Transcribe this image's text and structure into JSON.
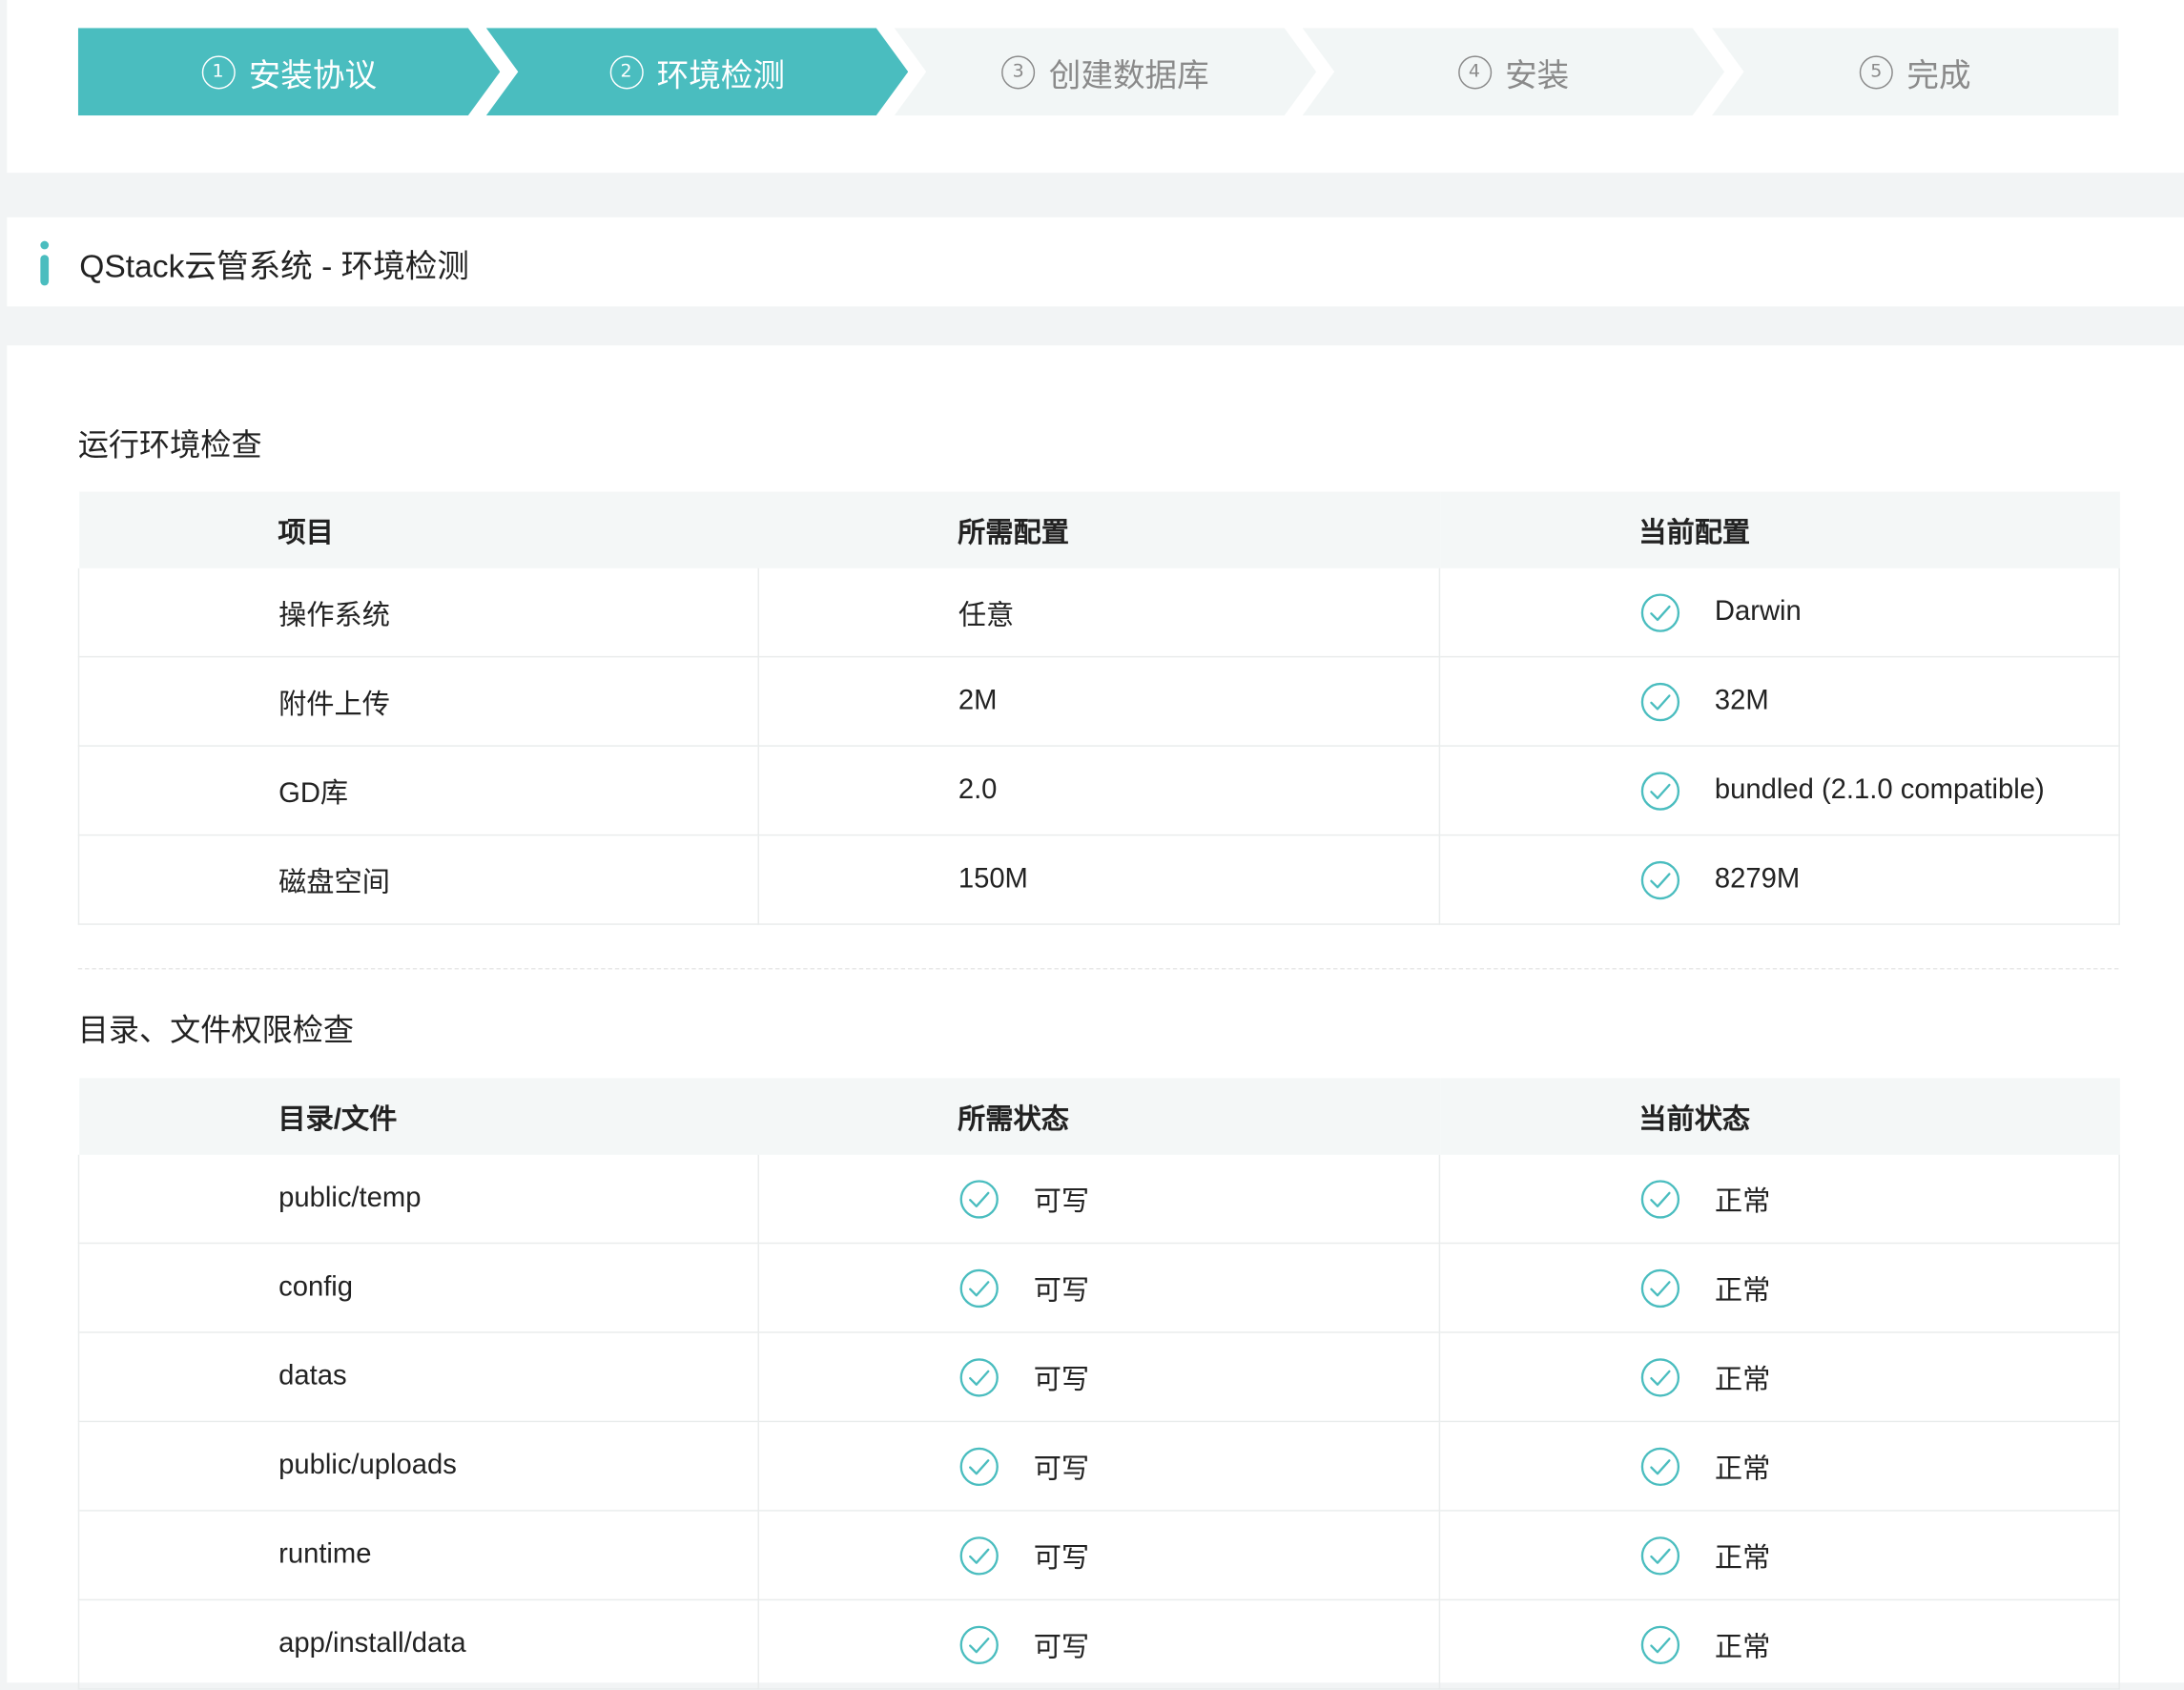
{
  "steps": [
    {
      "num": "1",
      "label": "安装协议",
      "active": true
    },
    {
      "num": "2",
      "label": "环境检测",
      "active": true
    },
    {
      "num": "3",
      "label": "创建数据库",
      "active": false
    },
    {
      "num": "4",
      "label": "安装",
      "active": false
    },
    {
      "num": "5",
      "label": "完成",
      "active": false
    }
  ],
  "page_title": "QStack云管系统 - 环境检测",
  "env_check": {
    "title": "运行环境检查",
    "headers": [
      "项目",
      "所需配置",
      "当前配置"
    ],
    "rows": [
      {
        "item": "操作系统",
        "required": "任意",
        "current": "Darwin"
      },
      {
        "item": "附件上传",
        "required": "2M",
        "current": "32M"
      },
      {
        "item": "GD库",
        "required": "2.0",
        "current": "bundled (2.1.0 compatible)"
      },
      {
        "item": "磁盘空间",
        "required": "150M",
        "current": "8279M"
      }
    ]
  },
  "perm_check": {
    "title": "目录、文件权限检查",
    "headers": [
      "目录/文件",
      "所需状态",
      "当前状态"
    ],
    "rows": [
      {
        "path": "public/temp",
        "required": "可写",
        "current": "正常"
      },
      {
        "path": "config",
        "required": "可写",
        "current": "正常"
      },
      {
        "path": "datas",
        "required": "可写",
        "current": "正常"
      },
      {
        "path": "public/uploads",
        "required": "可写",
        "current": "正常"
      },
      {
        "path": "runtime",
        "required": "可写",
        "current": "正常"
      },
      {
        "path": "app/install/data",
        "required": "可写",
        "current": "正常"
      }
    ]
  },
  "colors": {
    "accent": "#4abdbf",
    "inactive_step": "#f2f6f6",
    "header_bg": "#f4f7f7"
  },
  "icons": {
    "status": "check-circle-icon"
  }
}
